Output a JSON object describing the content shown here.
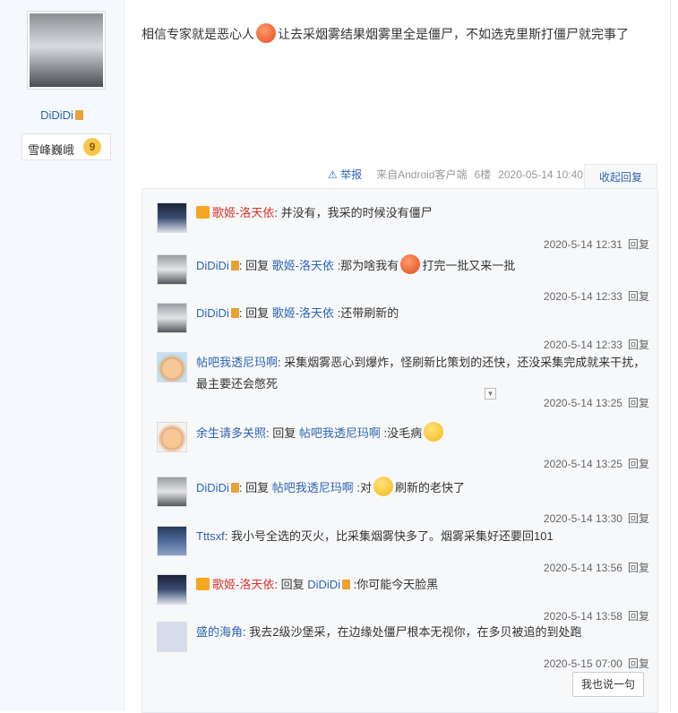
{
  "post": {
    "author": "DiDiDi",
    "badge_name": "雪峰巍峨",
    "badge_level": "9",
    "content_before": "相信专家就是恶心人",
    "content_after": "让去采烟雾结果烟雾里全是僵尸，不如选克里斯打僵尸就完事了",
    "report": "举报",
    "source": "来自Android客户端",
    "floor": "6楼",
    "datetime": "2020-05-14 10:40",
    "collapse": "收起回复"
  },
  "replies": [
    {
      "user": "歌姬-洛天依",
      "prefix": "",
      "target": "",
      "text": "并没有，我采的时候没有僵尸",
      "time": "2020-5-14 12:31",
      "reply_label": "回复"
    },
    {
      "user": "DiDiDi",
      "prefix": "回复",
      "target": "歌姬-洛天依",
      "text": ":那为啥我有",
      "text2": "打完一批又来一批",
      "time": "2020-5-14 12:33",
      "reply_label": "回复"
    },
    {
      "user": "DiDiDi",
      "prefix": "回复",
      "target": "歌姬-洛天依",
      "text": ":还带刷新的",
      "time": "2020-5-14 12:33",
      "reply_label": "回复"
    },
    {
      "user": "帖吧我透尼玛啊",
      "prefix": "",
      "target": "",
      "text": "采集烟雾恶心到爆炸，怪刷新比策划的还快，还没采集完成就来干扰，最主要还会憋死",
      "time": "2020-5-14 13:25",
      "reply_label": "回复"
    },
    {
      "user": "余生请多关照",
      "prefix": "回复",
      "target": "帖吧我透尼玛啊",
      "text": ":没毛病",
      "time": "2020-5-14 13:25",
      "reply_label": "回复"
    },
    {
      "user": "DiDiDi",
      "prefix": "回复",
      "target": "帖吧我透尼玛啊",
      "text": ":对",
      "text2": "刷新的老快了",
      "time": "2020-5-14 13:30",
      "reply_label": "回复"
    },
    {
      "user": "Tttsxf",
      "prefix": "",
      "target": "",
      "text": "我小号全选的灭火，比采集烟雾快多了。烟雾采集好还要回101",
      "time": "2020-5-14 13:56",
      "reply_label": "回复"
    },
    {
      "user": "歌姬-洛天依",
      "prefix": "回复",
      "target": "DiDiDi",
      "text": ":你可能今天脸黑",
      "time": "2020-5-14 13:58",
      "reply_label": "回复"
    },
    {
      "user": "盛的海角",
      "prefix": "",
      "target": "",
      "text": "我去2级沙堡采，在边缘处僵尸根本无视你，在多贝被追的到处跑",
      "time": "2020-5-15 07:00",
      "reply_label": "回复"
    }
  ],
  "say_button": "我也说一句"
}
